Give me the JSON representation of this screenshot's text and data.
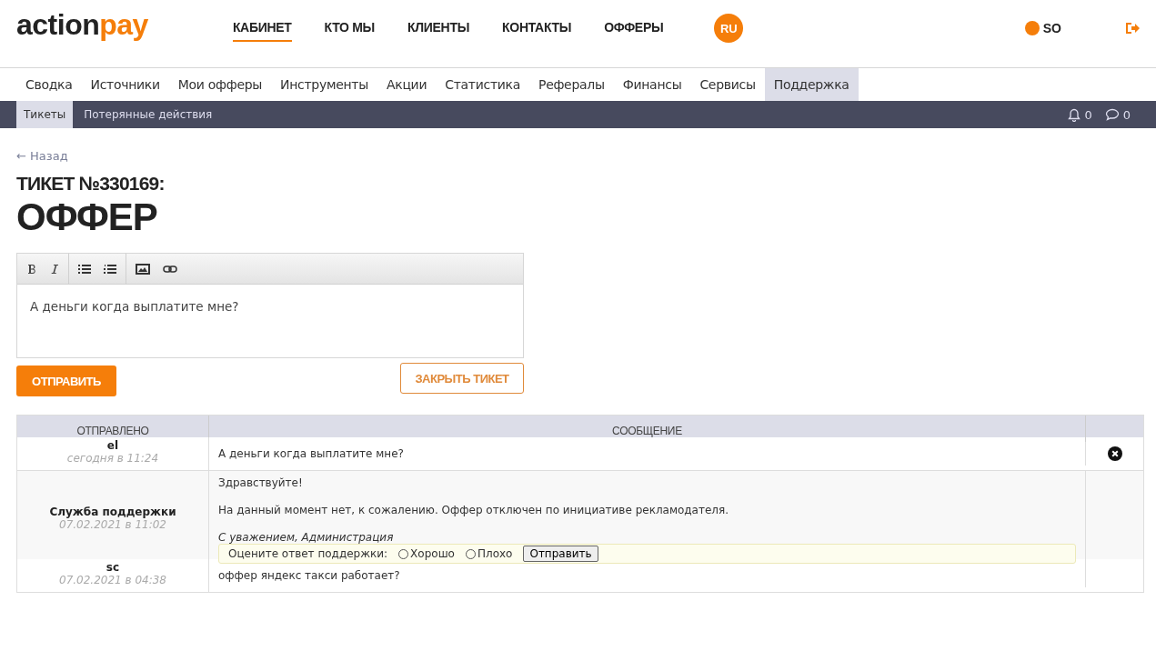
{
  "header": {
    "logo": {
      "main": "action",
      "accent": "pay"
    },
    "nav": [
      {
        "label": "КАБИНЕТ",
        "selected": true
      },
      {
        "label": "КТО МЫ",
        "selected": false
      },
      {
        "label": "КЛИЕНТЫ",
        "selected": false
      },
      {
        "label": "КОНТАКТЫ",
        "selected": false
      },
      {
        "label": "ОФФЕРЫ",
        "selected": false
      }
    ],
    "language": "RU",
    "user": "SO"
  },
  "menu": [
    {
      "label": "Сводка",
      "selected": false
    },
    {
      "label": "Источники",
      "selected": false
    },
    {
      "label": "Мои офферы",
      "selected": false
    },
    {
      "label": "Инструменты",
      "selected": false
    },
    {
      "label": "Акции",
      "selected": false
    },
    {
      "label": "Статистика",
      "selected": false
    },
    {
      "label": "Рефералы",
      "selected": false
    },
    {
      "label": "Финансы",
      "selected": false
    },
    {
      "label": "Сервисы",
      "selected": false
    },
    {
      "label": "Поддержка",
      "selected": true
    }
  ],
  "submenu": {
    "tabs": [
      {
        "label": "Тикеты",
        "selected": true
      },
      {
        "label": "Потерянные действия",
        "selected": false
      }
    ],
    "notifications": "0",
    "messages": "0"
  },
  "back_link": "← Назад",
  "ticket": {
    "number": "ТИКЕТ №330169:",
    "title": "ОФФЕР"
  },
  "editor": {
    "value": "А деньги когда выплатите мне?"
  },
  "buttons": {
    "send": "ОТПРАВИТЬ",
    "close": "ЗАКРЫТЬ ТИКЕТ"
  },
  "table": {
    "columns": [
      "ОТПРАВЛЕНО",
      "СООБЩЕНИЕ"
    ],
    "rows": [
      {
        "kind": "user",
        "sender": "el",
        "time": "сегодня в 11:24",
        "paragraphs": [
          "А деньги когда выплатите мне?"
        ],
        "deletable": true
      },
      {
        "kind": "support",
        "sender": "Служба поддержки",
        "time": "07.02.2021 в 11:02",
        "paragraphs": [
          "Здравствуйте!",
          "На данный момент нет, к сожалению. Оффер отключен по инициативе рекламодателя."
        ],
        "signature": "С уважением, Администрация",
        "rating": {
          "label": "Оцените ответ поддержки:",
          "options": [
            {
              "label": "Хорошо",
              "selected": false
            },
            {
              "label": "Плохо",
              "selected": false
            }
          ],
          "button": "Отправить"
        },
        "deletable": false
      },
      {
        "kind": "user",
        "sender": "sc",
        "time": "07.02.2021 в 04:38",
        "paragraphs": [
          "оффер яндекс такси работает?"
        ],
        "deletable": false
      }
    ]
  }
}
